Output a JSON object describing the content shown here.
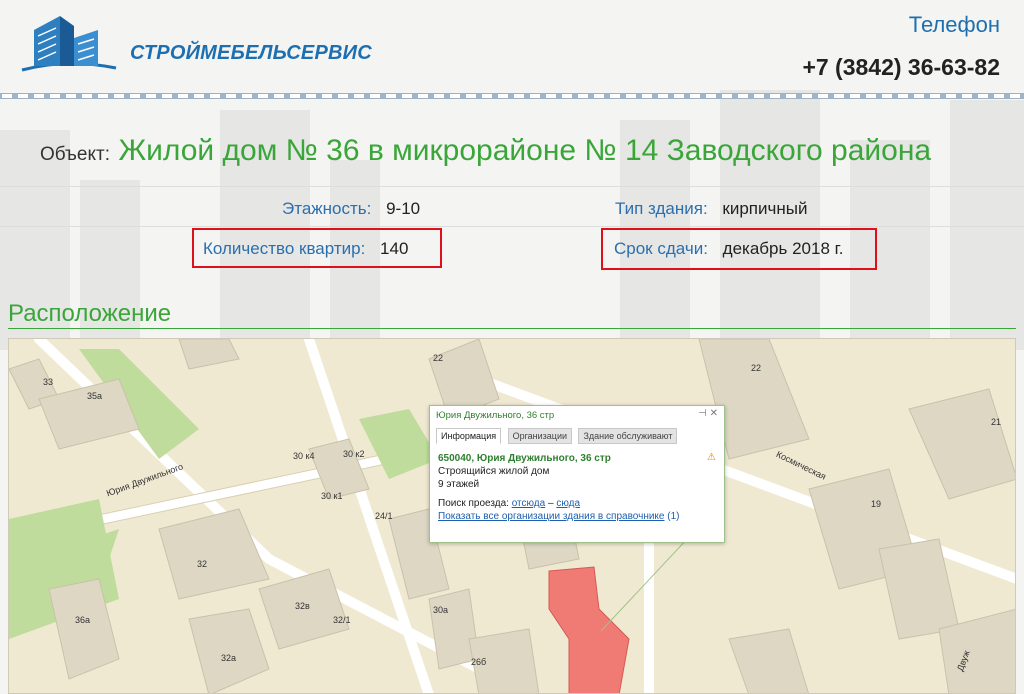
{
  "header": {
    "logo_text": "СТРОЙМЕБЕЛЬСЕРВИС",
    "phone_label": "Телефон",
    "phone_number": "+7 (3842) 36-63-82"
  },
  "object": {
    "label": "Объект:",
    "name": "Жилой дом № 36 в микрорайоне № 14 Заводского района"
  },
  "details": {
    "floors_label": "Этажность:",
    "floors_value": "9-10",
    "type_label": "Тип здания:",
    "type_value": "кирпичный",
    "apartments_label": "Количество квартир:",
    "apartments_value": "140",
    "deadline_label": "Срок сдачи:",
    "deadline_value": "декабрь 2018 г."
  },
  "section": {
    "location_title": "Расположение"
  },
  "map": {
    "popup": {
      "title": "Юрия Двужильного, 36 стр",
      "tabs": [
        "Информация",
        "Организации",
        "Здание обслуживают"
      ],
      "address": "650040, Юрия Двужильного, 36 стр",
      "desc": "Строящийся жилой дом",
      "floors": "9 этажей",
      "route_label": "Поиск проезда:",
      "route_from": "отсюда",
      "route_sep": "–",
      "route_to": "сюда",
      "show_all": "Показать все организации здания в справочнике",
      "show_all_count": "(1)"
    },
    "labels": {
      "b33": "33",
      "b35a": "35а",
      "b22": "22",
      "b30k4": "30 к4",
      "b30k2": "30 к2",
      "b30k1": "30 к1",
      "b24_1": "24/1",
      "b32": "32",
      "b32v": "32в",
      "b32_1": "32/1",
      "b30a": "30а",
      "b26b": "26б",
      "b36a": "36а",
      "b32a": "32а",
      "b19": "19",
      "b21": "21",
      "b22r": "22",
      "street1": "Юрия Двужильного",
      "street2": "Космическая",
      "street3": "Двуж"
    }
  },
  "colors": {
    "accent_green": "#3aa63a",
    "link_blue": "#2a6fb0",
    "highlight_red": "#e0101a",
    "construction_red": "#f07a74"
  }
}
